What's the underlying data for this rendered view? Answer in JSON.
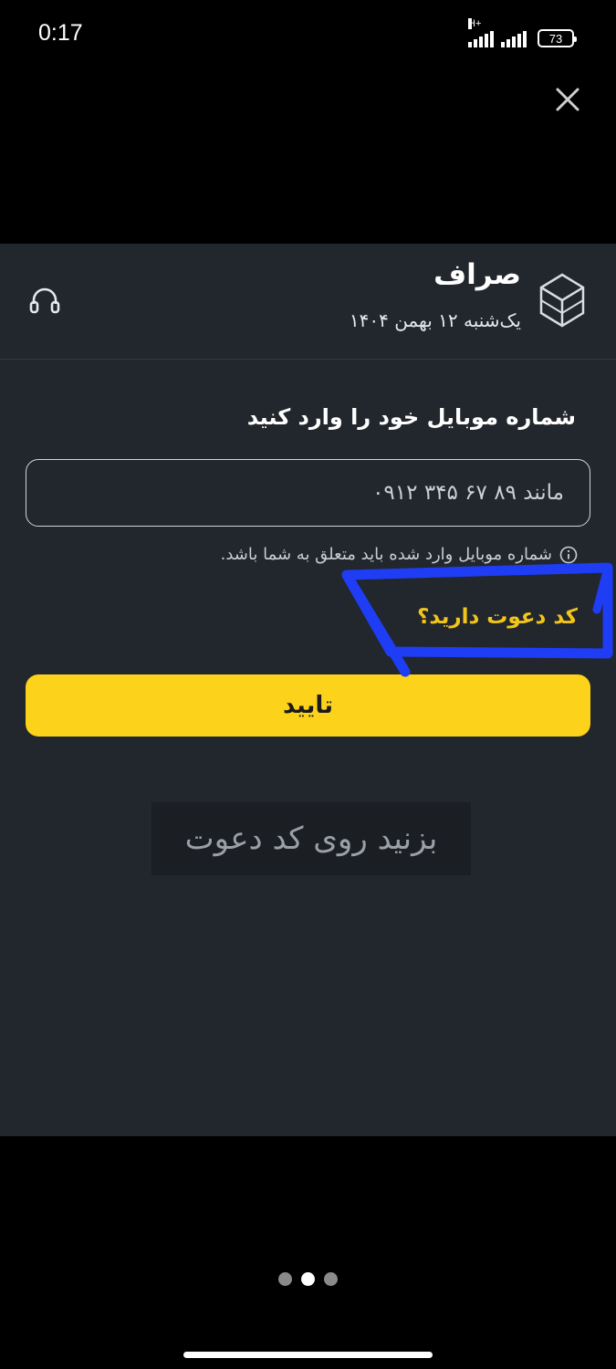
{
  "status_bar": {
    "time": "0:17",
    "network": "H+",
    "battery": "73"
  },
  "header": {
    "brand": "صراف",
    "date": "یک‌شنبه ۱۲ بهمن ۱۴۰۴",
    "logo_icon": "cube-logo-icon",
    "support_icon": "headset-icon"
  },
  "form": {
    "title": "شماره موبایل خود را وارد کنید",
    "phone_placeholder": "مانند ۸۹ ۶۷ ۳۴۵ ۰۹۱۲",
    "hint": "شماره موبایل وارد شده باید متعلق به شما باشد.",
    "invite_link": "کد دعوت دارید؟",
    "confirm_label": "تایید"
  },
  "caption": "بزنید روی کد دعوت",
  "pager": {
    "count": 3,
    "active_index": 1
  },
  "colors": {
    "sheet_background": "#22272d",
    "accent_yellow": "#fcd21a",
    "link_yellow": "#f2c51a",
    "annotation_blue": "#1e3df5"
  }
}
